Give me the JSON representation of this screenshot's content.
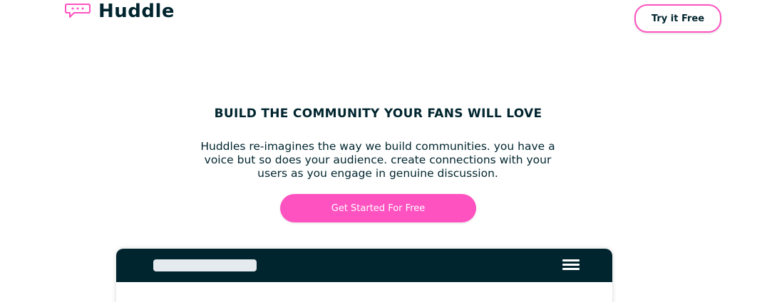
{
  "header": {
    "logo_text": "Huddle",
    "logo_icon": "speech-bubble-icon",
    "cta_label": "Try it Free"
  },
  "hero": {
    "title": "BUILD THE COMMUNITY YOUR FANS WILL LOVE",
    "description": "Huddles re-imagines the way we build communities. you have a voice but so does your audience. create connections with your users as you engage in genuine discussion.",
    "cta_label": "Get Started For Free"
  },
  "mockup": {
    "menu_icon": "hamburger-menu-icon"
  },
  "colors": {
    "dark": "#00252e",
    "accent": "#ff52c1",
    "placeholder": "#e4eaee",
    "background": "#ffffff"
  }
}
